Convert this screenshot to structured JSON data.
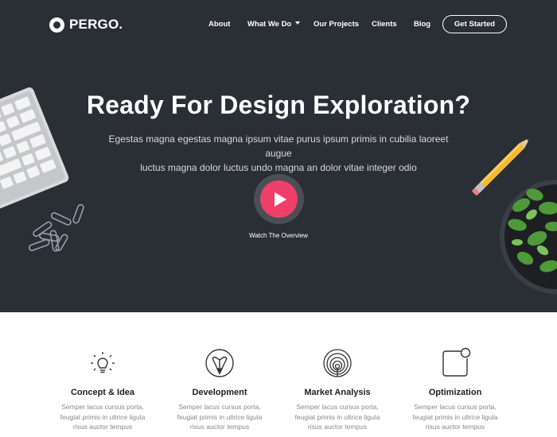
{
  "brand": {
    "name": "PERGO.",
    "logo_icon": "circle-logo-icon"
  },
  "nav": {
    "items": [
      "About",
      "What We Do",
      "Our Projects",
      "Clients",
      "Blog"
    ],
    "cta": "Get Started"
  },
  "hero": {
    "title": "Ready For Design Exploration?",
    "subtitle_line1": "Egestas magna egestas magna ipsum vitae purus ipsum primis in cubilia laoreet augue",
    "subtitle_line2": "luctus magna dolor luctus undo magna an dolor vitae integer odio",
    "play_icon": "play-icon",
    "watch_label": "Watch The Overview"
  },
  "features": [
    {
      "icon": "lightbulb-icon",
      "title": "Concept & Idea",
      "desc": [
        "Semper lacus cursus porta,",
        "feugiat primis in ultrice ligula",
        "risus auctor tempus"
      ]
    },
    {
      "icon": "pencil-circle-icon",
      "title": "Development",
      "desc": [
        "Semper lacus cursus porta,",
        "feugiat primis in ultrice ligula",
        "risus auctor tempus"
      ]
    },
    {
      "icon": "concentric-circles-icon",
      "title": "Market Analysis",
      "desc": [
        "Semper lacus cursus porta,",
        "feugiat primis in ultrice ligula",
        "risus auctor tempus"
      ]
    },
    {
      "icon": "square-badge-icon",
      "title": "Optimization",
      "desc": [
        "Semper lacus cursus porta,",
        "feugiat primis in ultrice ligula",
        "risus auctor tempus"
      ]
    }
  ],
  "colors": {
    "hero_bg": "#2a2e35",
    "accent": "#ee3f6a",
    "text_dark": "#222222",
    "text_muted": "#888888"
  }
}
